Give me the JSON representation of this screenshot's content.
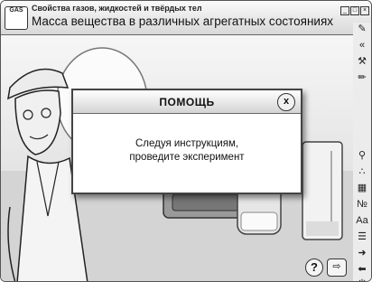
{
  "window": {
    "logo_text": "GAS",
    "subtitle": "Свойства газов, жидкостей и твёрдых тел",
    "title": "Масса вещества в различных агрегатных состояниях",
    "controls": [
      "minimize",
      "maximize",
      "close"
    ]
  },
  "dialog": {
    "title": "ПОМОЩЬ",
    "close_label": "x",
    "message_line1": "Следуя инструкциям,",
    "message_line2": "проведите эксперимент"
  },
  "bottom": {
    "help_label": "?",
    "exit_icon": "exit-icon"
  },
  "toolbar": {
    "items": [
      "eye-dropper-icon",
      "rewind-icon",
      "wrench-icon",
      "pencil-icon",
      "zoom-icon",
      "molecules-icon",
      "table-icon",
      "nb-icon",
      "font-icon",
      "list-icon",
      "arrow-right-icon",
      "arrow-left-icon",
      "power-icon"
    ]
  },
  "colors": {
    "frame": "#555555",
    "dialog_border": "#444444",
    "background": "#e8e8e8"
  }
}
